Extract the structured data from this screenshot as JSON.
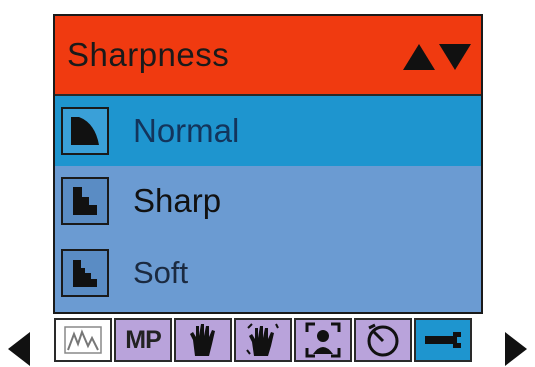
{
  "menu": {
    "title": "Sharpness",
    "options": [
      {
        "label": "Normal",
        "selected": true
      },
      {
        "label": "Sharp",
        "selected": false
      },
      {
        "label": "Soft",
        "selected": false
      }
    ]
  },
  "tabs": [
    {
      "icon": "waveform-icon",
      "label": ""
    },
    {
      "icon": "megapixel-icon",
      "label": "MP"
    },
    {
      "icon": "hand-icon",
      "label": ""
    },
    {
      "icon": "hand-stabilizer-icon",
      "label": ""
    },
    {
      "icon": "face-detect-icon",
      "label": ""
    },
    {
      "icon": "timer-icon",
      "label": ""
    },
    {
      "icon": "wrench-icon",
      "label": ""
    }
  ],
  "colors": {
    "header": "#f03a10",
    "panel": "#6b9bd2",
    "selected": "#1e95cf",
    "tab": "#b9a3db"
  }
}
